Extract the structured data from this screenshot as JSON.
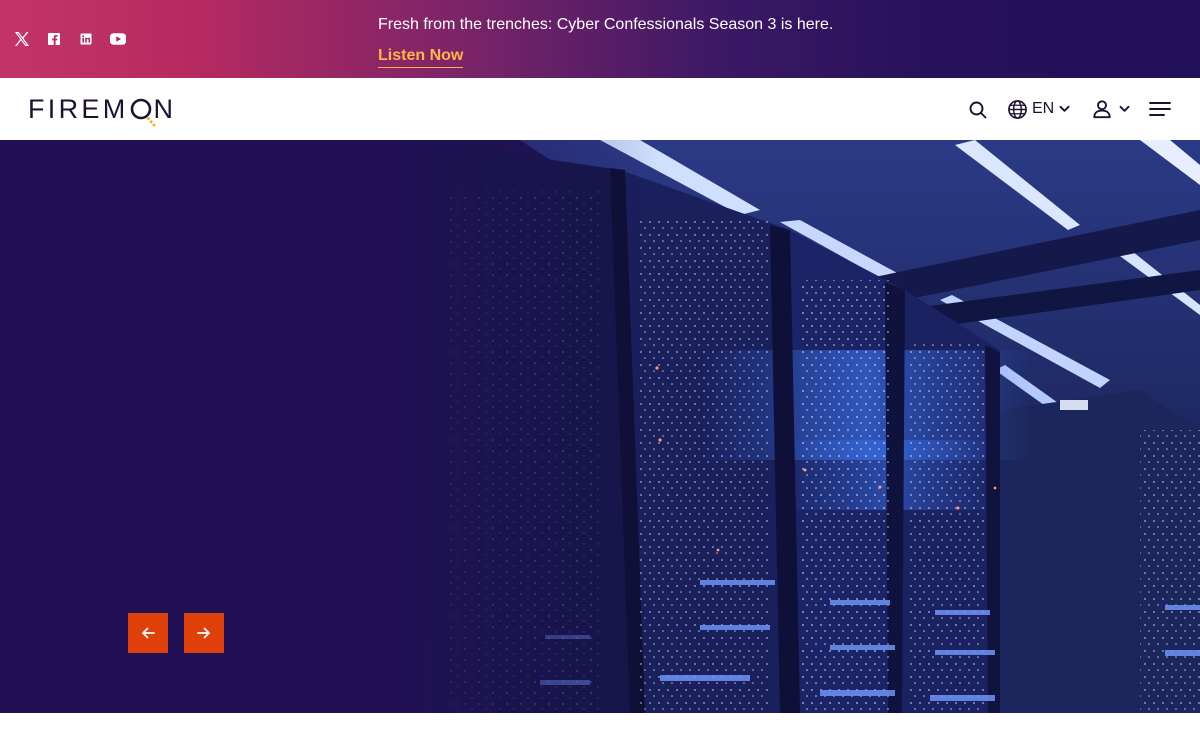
{
  "announcement": {
    "text": "Fresh from the trenches: Cyber Confessionals Season 3 is here.",
    "link_label": "Listen Now"
  },
  "social": {
    "icons": [
      "x-icon",
      "facebook-icon",
      "linkedin-icon",
      "youtube-icon"
    ]
  },
  "header": {
    "logo_text_left": "FIREM",
    "logo_text_right": "N",
    "language_code": "EN",
    "icons": [
      "search-icon",
      "globe-icon",
      "chevron-down-icon",
      "user-icon",
      "hamburger-menu-icon"
    ]
  },
  "hero": {
    "carousel_icons": [
      "arrow-left-icon",
      "arrow-right-icon"
    ]
  },
  "colors": {
    "brand_dark": "#1c1133",
    "accent_orange": "#e0410a",
    "link_gold": "#ffb446",
    "hero_purple": "#221055"
  }
}
